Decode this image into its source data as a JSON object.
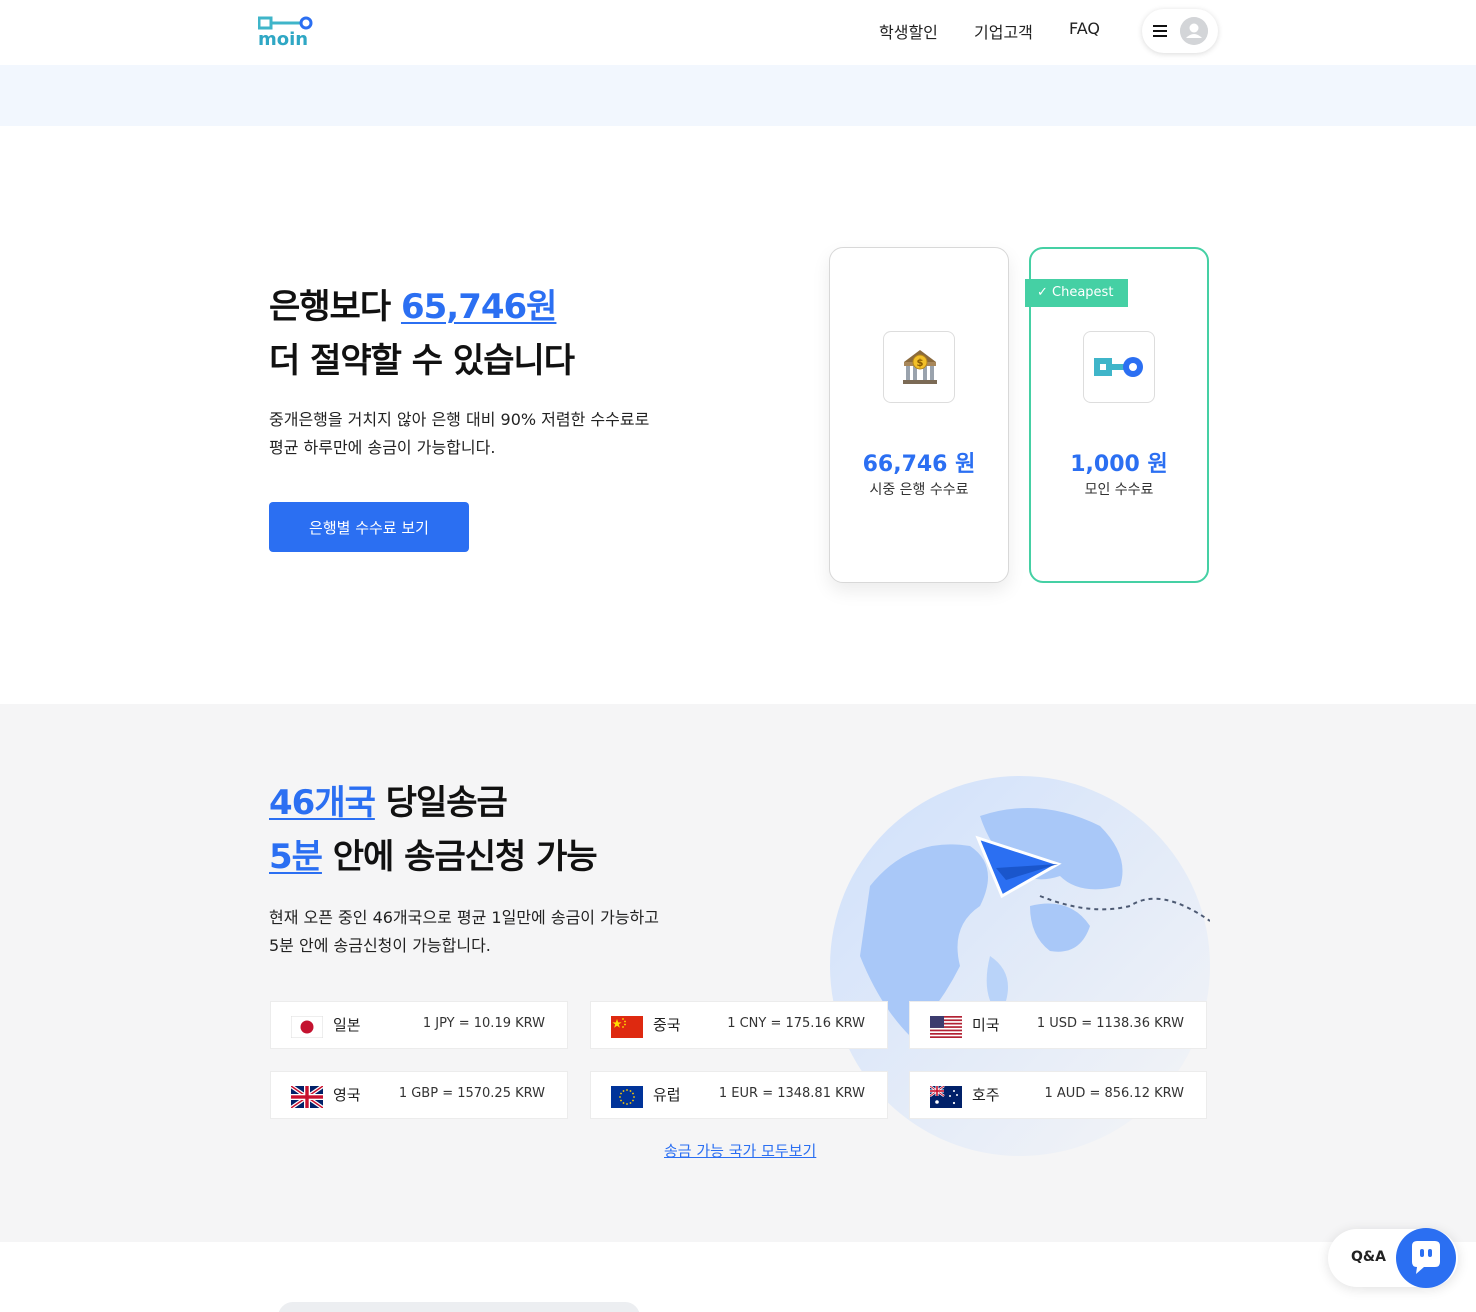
{
  "header": {
    "nav": [
      {
        "label": "학생할인"
      },
      {
        "label": "기업고객"
      },
      {
        "label": "FAQ"
      }
    ]
  },
  "hero": {
    "title_prefix": "은행보다 ",
    "title_amount": "65,746원",
    "title_line2": "더 절약할 수 있습니다",
    "desc_line1": "중개은행을 거치지 않아 은행 대비 90% 저렴한 수수료로",
    "desc_line2": "평균 하루만에 송금이 가능합니다.",
    "cta_label": "은행별 수수료 보기"
  },
  "compare": {
    "bank_amount": "66,746 원",
    "bank_label": "시중 은행 수수료",
    "moin_amount": "1,000 원",
    "moin_label": "모인 수수료",
    "badge": "✓ Cheapest"
  },
  "countries": {
    "title_count": "46개국",
    "title_rest1": " 당일송금",
    "title_time": "5분",
    "title_rest2": " 안에 송금신청 가능",
    "desc_line1": "현재 오픈 중인 46개국으로 평균 1일만에 송금이 가능하고",
    "desc_line2": "5분 안에 송금신청이 가능합니다.",
    "rates": [
      {
        "name": "일본",
        "rate": "1 JPY = 10.19 KRW",
        "flag": "jp-flag"
      },
      {
        "name": "중국",
        "rate": "1 CNY = 175.16 KRW",
        "flag": "cn-flag"
      },
      {
        "name": "미국",
        "rate": "1 USD = 1138.36 KRW",
        "flag": "us-flag"
      },
      {
        "name": "영국",
        "rate": "1 GBP = 1570.25 KRW",
        "flag": "gb-flag"
      },
      {
        "name": "유럽",
        "rate": "1 EUR = 1348.81 KRW",
        "flag": "eu-flag"
      },
      {
        "name": "호주",
        "rate": "1 AUD = 856.12 KRW",
        "flag": "au-flag"
      }
    ],
    "view_all": "송금 가능 국가 모두보기"
  },
  "floating": {
    "qa_label": "Q&A"
  },
  "colors": {
    "accent": "#2b6ff2",
    "moin_teal": "#45d0a4",
    "section_bg": "#f5f5f6",
    "banner_bg": "#f2f7fe"
  }
}
